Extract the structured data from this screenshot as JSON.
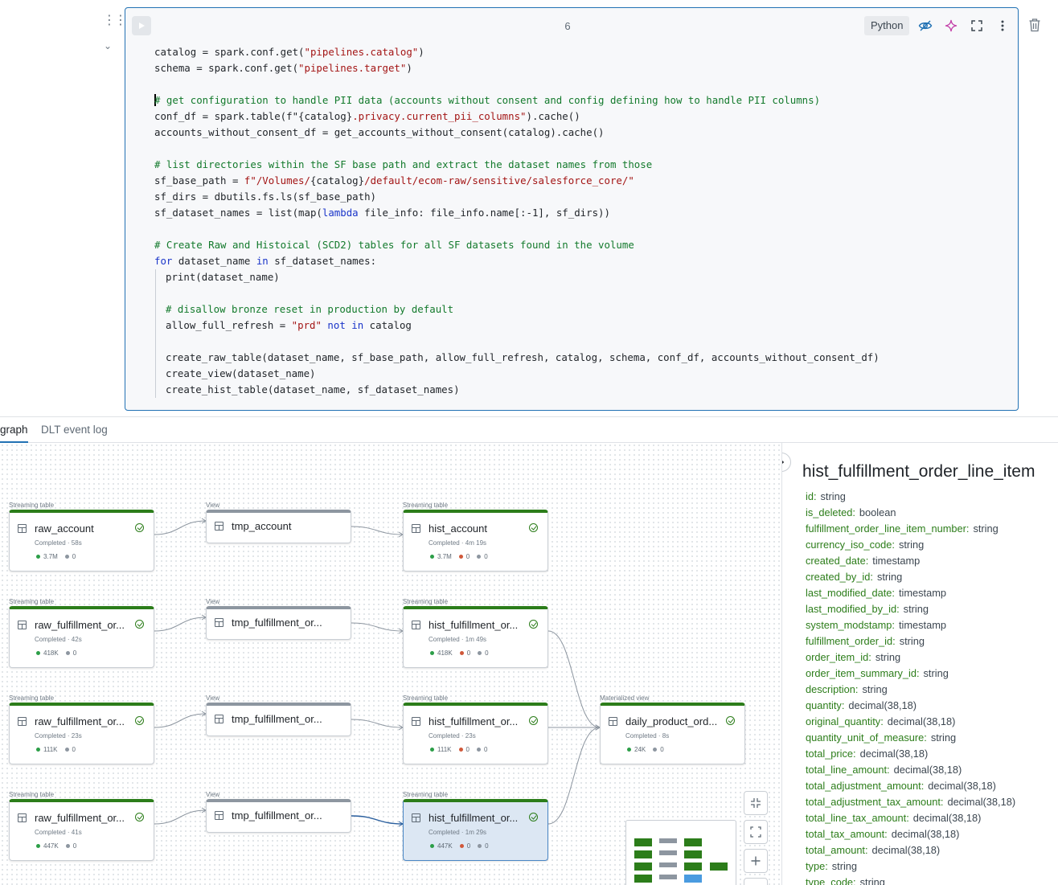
{
  "cell": {
    "number": "6",
    "language": "Python",
    "run_icon": "play-icon",
    "lines": [
      [
        {
          "t": "catalog = spark.conf.get("
        },
        {
          "t": "\"pipelines.catalog\"",
          "c": "str"
        },
        {
          "t": ")"
        }
      ],
      [
        {
          "t": "schema = spark.conf.get("
        },
        {
          "t": "\"pipelines.target\"",
          "c": "str"
        },
        {
          "t": ")"
        }
      ],
      [],
      [
        {
          "t": "# get configuration to handle PII data (accounts without consent and config defining how to handle PII columns)",
          "c": "cm",
          "caret": true
        }
      ],
      [
        {
          "t": "conf_df = spark.table(f\""
        },
        {
          "t": "{catalog}",
          "c": "plain"
        },
        {
          "t": ".privacy.current_pii_columns\"",
          "c": "str"
        },
        {
          "t": ").cache()"
        }
      ],
      [
        {
          "t": "accounts_without_consent_df = get_accounts_without_consent(catalog).cache()"
        }
      ],
      [],
      [
        {
          "t": "# list directories within the SF base path and extract the dataset names from those",
          "c": "cm"
        }
      ],
      [
        {
          "t": "sf_base_path = "
        },
        {
          "t": "f\"/Volumes/",
          "c": "str"
        },
        {
          "t": "{catalog}"
        },
        {
          "t": "/default/ecom-raw/sensitive/salesforce_core/\"",
          "c": "str"
        }
      ],
      [
        {
          "t": "sf_dirs = dbutils.fs.ls(sf_base_path)"
        }
      ],
      [
        {
          "t": "sf_dataset_names = list(map("
        },
        {
          "t": "lambda",
          "c": "kw"
        },
        {
          "t": " file_info: file_info.name[:-1], sf_dirs))"
        }
      ],
      [],
      [
        {
          "t": "# Create Raw and Histoical (SCD2) tables for all SF datasets found in the volume",
          "c": "cm"
        }
      ],
      [
        {
          "t": "for",
          "c": "kw"
        },
        {
          "t": " dataset_name "
        },
        {
          "t": "in",
          "c": "kw"
        },
        {
          "t": " sf_dataset_names:"
        }
      ],
      [
        {
          "t": "print(dataset_name)",
          "indent": true
        }
      ],
      [
        {
          "t": "",
          "indent": true
        }
      ],
      [
        {
          "t": "# disallow bronze reset in production by default",
          "c": "cm",
          "indent": true
        }
      ],
      [
        {
          "t": "allow_full_refresh = ",
          "indent": true
        },
        {
          "t": "\"prd\"",
          "c": "str"
        },
        {
          "t": " not in",
          "c": "kw"
        },
        {
          "t": " catalog"
        }
      ],
      [
        {
          "t": "",
          "indent": true
        }
      ],
      [
        {
          "t": "create_raw_table(dataset_name, sf_base_path, allow_full_refresh, catalog, schema, conf_df, accounts_without_consent_df)",
          "indent": true
        }
      ],
      [
        {
          "t": "create_view(dataset_name)",
          "indent": true
        }
      ],
      [
        {
          "t": "create_hist_table(dataset_name, sf_dataset_names)",
          "indent": true
        }
      ]
    ]
  },
  "tabs": [
    {
      "label": "graph",
      "active": true
    },
    {
      "label": "DLT event log",
      "active": false
    }
  ],
  "graph": {
    "nodes": [
      {
        "id": "n1",
        "type": "Streaming table",
        "title": "raw_account",
        "status": "Completed · 58s",
        "stats": [
          {
            "c": "g",
            "v": "3.7M"
          },
          {
            "c": "s",
            "v": "0"
          }
        ],
        "accent": "green",
        "check": true
      },
      {
        "id": "n2",
        "type": "View",
        "title": "tmp_account",
        "accent": "gray"
      },
      {
        "id": "n3",
        "type": "Streaming table",
        "title": "hist_account",
        "status": "Completed · 4m 19s",
        "stats": [
          {
            "c": "g",
            "v": "3.7M"
          },
          {
            "c": "o",
            "v": "0"
          },
          {
            "c": "s",
            "v": "0"
          }
        ],
        "accent": "green",
        "check": true
      },
      {
        "id": "n4",
        "type": "Streaming table",
        "title": "raw_fulfillment_or...",
        "status": "Completed · 42s",
        "stats": [
          {
            "c": "g",
            "v": "418K"
          },
          {
            "c": "s",
            "v": "0"
          }
        ],
        "accent": "green",
        "check": true
      },
      {
        "id": "n5",
        "type": "View",
        "title": "tmp_fulfillment_or...",
        "accent": "gray"
      },
      {
        "id": "n6",
        "type": "Streaming table",
        "title": "hist_fulfillment_or...",
        "status": "Completed · 1m 49s",
        "stats": [
          {
            "c": "g",
            "v": "418K"
          },
          {
            "c": "o",
            "v": "0"
          },
          {
            "c": "s",
            "v": "0"
          }
        ],
        "accent": "green",
        "check": true
      },
      {
        "id": "n7",
        "type": "Streaming table",
        "title": "raw_fulfillment_or...",
        "status": "Completed · 23s",
        "stats": [
          {
            "c": "g",
            "v": "111K"
          },
          {
            "c": "s",
            "v": "0"
          }
        ],
        "accent": "green",
        "check": true
      },
      {
        "id": "n8",
        "type": "View",
        "title": "tmp_fulfillment_or...",
        "accent": "gray"
      },
      {
        "id": "n9",
        "type": "Streaming table",
        "title": "hist_fulfillment_or...",
        "status": "Completed · 23s",
        "stats": [
          {
            "c": "g",
            "v": "111K"
          },
          {
            "c": "o",
            "v": "0"
          },
          {
            "c": "s",
            "v": "0"
          }
        ],
        "accent": "green",
        "check": true
      },
      {
        "id": "n10",
        "type": "Materialized view",
        "title": "daily_product_ord...",
        "status": "Completed · 8s",
        "stats": [
          {
            "c": "g",
            "v": "24K"
          },
          {
            "c": "s",
            "v": "0"
          }
        ],
        "accent": "green",
        "check": true
      },
      {
        "id": "n11",
        "type": "Streaming table",
        "title": "raw_fulfillment_or...",
        "status": "Completed · 41s",
        "stats": [
          {
            "c": "g",
            "v": "447K"
          },
          {
            "c": "s",
            "v": "0"
          }
        ],
        "accent": "green",
        "check": true
      },
      {
        "id": "n12",
        "type": "View",
        "title": "tmp_fulfillment_or...",
        "accent": "gray"
      },
      {
        "id": "n13",
        "type": "Streaming table",
        "title": "hist_fulfillment_or...",
        "status": "Completed · 1m 29s",
        "stats": [
          {
            "c": "g",
            "v": "447K"
          },
          {
            "c": "o",
            "v": "0"
          },
          {
            "c": "s",
            "v": "0"
          }
        ],
        "accent": "green",
        "check": true,
        "selected": true
      }
    ],
    "controls": [
      "collapse-icon",
      "fit-view-icon",
      "zoom-in-icon"
    ],
    "colors": {
      "accent": "#2c7d1a",
      "view": "#8d96a0",
      "selected_bg": "#dce7f3",
      "edge": "#8d96a0",
      "edge_selected": "#2a5f9e"
    }
  },
  "panel": {
    "title": "hist_fulfillment_order_line_item",
    "columns": [
      {
        "name": "id:",
        "type": "string"
      },
      {
        "name": "is_deleted:",
        "type": "boolean"
      },
      {
        "name": "fulfillment_order_line_item_number:",
        "type": "string"
      },
      {
        "name": "currency_iso_code:",
        "type": "string"
      },
      {
        "name": "created_date:",
        "type": "timestamp"
      },
      {
        "name": "created_by_id:",
        "type": "string"
      },
      {
        "name": "last_modified_date:",
        "type": "timestamp"
      },
      {
        "name": "last_modified_by_id:",
        "type": "string"
      },
      {
        "name": "system_modstamp:",
        "type": "timestamp"
      },
      {
        "name": "fulfillment_order_id:",
        "type": "string"
      },
      {
        "name": "order_item_id:",
        "type": "string"
      },
      {
        "name": "order_item_summary_id:",
        "type": "string"
      },
      {
        "name": "description:",
        "type": "string"
      },
      {
        "name": "quantity:",
        "type": "decimal(38,18)"
      },
      {
        "name": "original_quantity:",
        "type": "decimal(38,18)"
      },
      {
        "name": "quantity_unit_of_measure:",
        "type": "string"
      },
      {
        "name": "total_price:",
        "type": "decimal(38,18)"
      },
      {
        "name": "total_line_amount:",
        "type": "decimal(38,18)"
      },
      {
        "name": "total_adjustment_amount:",
        "type": "decimal(38,18)"
      },
      {
        "name": "total_adjustment_tax_amount:",
        "type": "decimal(38,18)"
      },
      {
        "name": "total_line_tax_amount:",
        "type": "decimal(38,18)"
      },
      {
        "name": "total_tax_amount:",
        "type": "decimal(38,18)"
      },
      {
        "name": "total_amount:",
        "type": "decimal(38,18)"
      },
      {
        "name": "type:",
        "type": "string"
      },
      {
        "name": "type_code:",
        "type": "string"
      }
    ]
  }
}
